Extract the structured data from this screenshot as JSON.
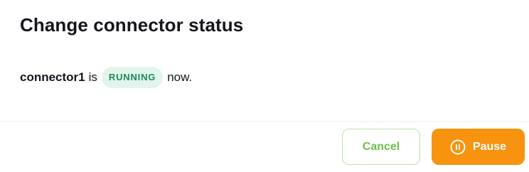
{
  "modal": {
    "title": "Change connector status"
  },
  "message": {
    "connector_name": "connector1",
    "word_is": "is",
    "status": "RUNNING",
    "suffix": "now."
  },
  "footer": {
    "cancel_label": "Cancel",
    "pause_label": "Pause",
    "pause_icon": "pause-circle-icon"
  },
  "colors": {
    "status_badge_bg": "#e2f5ec",
    "status_badge_text": "#1d8a55",
    "cancel_border": "#b8e3a8",
    "cancel_text": "#6cc04a",
    "pause_bg": "#f7930e"
  }
}
